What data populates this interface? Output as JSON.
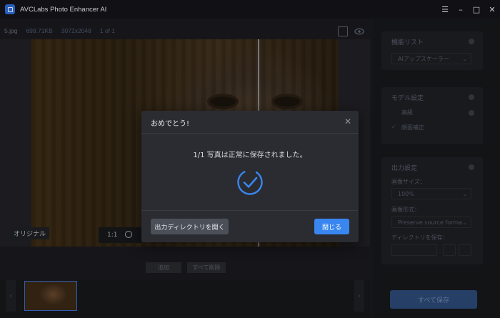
{
  "window": {
    "title": "AVCLabs Photo Enhancer AI",
    "controls": {
      "menu": "☰",
      "minimize": "–",
      "maximize": "□",
      "close": "✕"
    }
  },
  "image_info": {
    "filename": "5.jpg",
    "size": "699.71KB",
    "resolution": "3072x2048",
    "index": "1 of 1"
  },
  "preview": {
    "original_label": "オリジナル",
    "zoom_level": "1:1"
  },
  "actions": {
    "add_label": "追加",
    "delete_all_label": "すべて削除"
  },
  "right_panel": {
    "features": {
      "title": "機能リスト",
      "selected": "AIアップスケーラー"
    },
    "model": {
      "title": "モデル設定",
      "advanced": "高級",
      "face_correction": "顔面補正"
    },
    "output": {
      "title": "出力設定",
      "image_size_label": "画像サイズ：",
      "image_size_value": "100%",
      "format_label": "画像形式：",
      "format_value": "Preserve source forma",
      "directory_label": "ディレクトリを保存："
    },
    "save_all_label": "すべて保存"
  },
  "dialog": {
    "title": "おめでとう!",
    "message": "1/1 写真は正常に保存されました。",
    "open_dir_label": "出力ディレクトリを開く",
    "close_label": "閉じる"
  },
  "colors": {
    "accent": "#3a86f0",
    "dialog_bg": "#2a2c31",
    "app_bg": "#1a1b1f"
  }
}
